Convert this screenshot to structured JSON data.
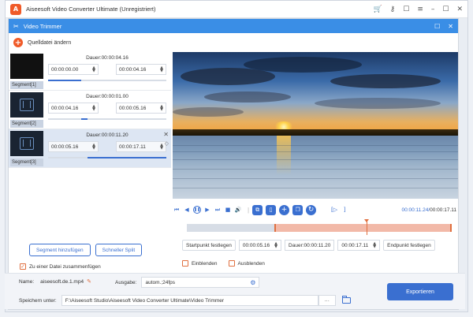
{
  "app": {
    "title": "Aiseesoft Video Converter Ultimate (Unregistriert)",
    "logo_letter": "A",
    "titlebar_icons": [
      "cart-icon",
      "key-icon",
      "chat-icon",
      "menu-icon",
      "minimize-icon",
      "maximize-icon",
      "close-icon"
    ]
  },
  "dialog": {
    "title": "Video Trimmer",
    "source_label": "Quelldatei ändern"
  },
  "segments": [
    {
      "label": "Segment[1]",
      "duration": "Dauer:00:00:04.16",
      "start": "00:00:00.00",
      "end": "00:00:04.16",
      "track_from": 0.0,
      "track_to": 0.28,
      "thumb": "black"
    },
    {
      "label": "Segment[2]",
      "duration": "Dauer:00:00:01.00",
      "start": "00:00:04.16",
      "end": "00:00:05.16",
      "track_from": 0.28,
      "track_to": 0.33,
      "thumb": "film"
    },
    {
      "label": "Segment[3]",
      "duration": "Dauer:00:00:11.20",
      "start": "00:00:05.16",
      "end": "00:00:17.11",
      "track_from": 0.33,
      "track_to": 1.0,
      "thumb": "film"
    }
  ],
  "segment_buttons": {
    "add": "Segment hinzufügen",
    "quick_split": "Schneller Split"
  },
  "merge": {
    "label": "Zu einer Datei zusammenfügen",
    "checked": true
  },
  "player": {
    "current_time": "00:00:11.24",
    "total_time": "00:00:17.11",
    "selection_from": 0.33,
    "selection_to": 1.0,
    "playhead": 0.68
  },
  "trim": {
    "set_start": "Startpunkt festlegen",
    "start_value": "00:00:05.16",
    "duration": "Dauer:00:00:11.20",
    "end_value": "00:00:17.11",
    "set_end": "Endpunkt festlegen"
  },
  "fade": {
    "fade_in": "Einblenden",
    "fade_out": "Ausblenden"
  },
  "output": {
    "name_label": "Name:",
    "name_value": "aiseesoft.de.1.mp4",
    "format_label": "Ausgabe:",
    "format_value": "autom.;24fps",
    "save_label": "Speichern unter:",
    "save_path": "F:\\Aiseesoft Studio\\Aiseesoft Video Converter Ultimate\\Video Trimmer",
    "browse": "···",
    "export": "Exportieren"
  }
}
